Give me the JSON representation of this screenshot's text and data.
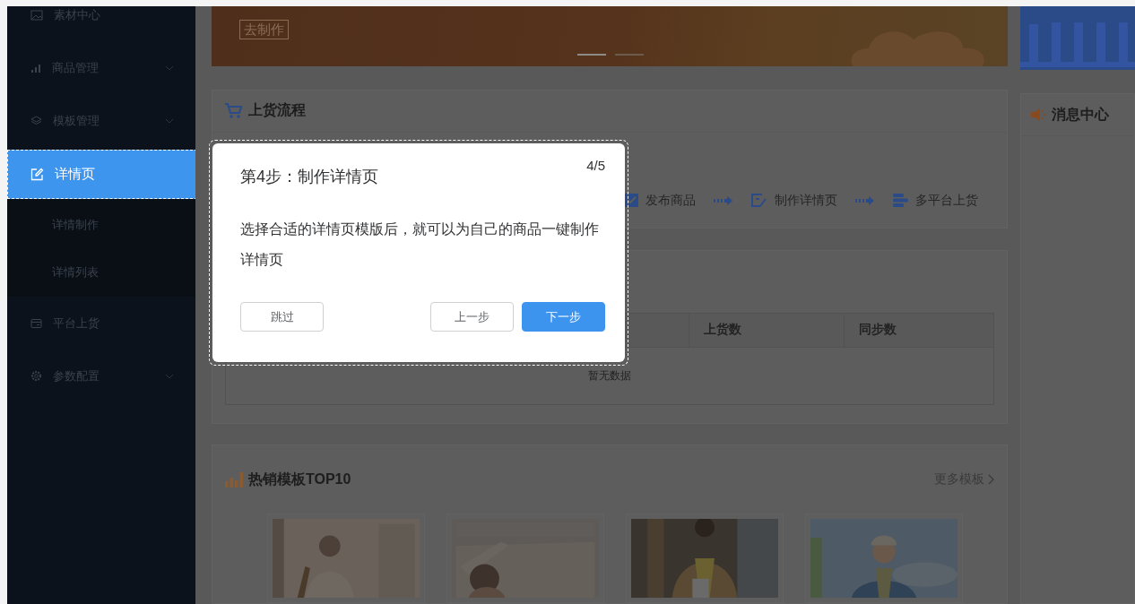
{
  "sidebar": {
    "items": [
      {
        "label": "素材中心",
        "kind": "link",
        "selected": false
      },
      {
        "label": "商品管理",
        "kind": "submenu",
        "selected": false
      },
      {
        "label": "模板管理",
        "kind": "submenu",
        "selected": false
      },
      {
        "label": "详情页",
        "kind": "link",
        "selected": true,
        "children": [
          {
            "label": "详情制作",
            "selected": false
          },
          {
            "label": "详情列表",
            "selected": false
          }
        ]
      },
      {
        "label": "平台上货",
        "kind": "link",
        "selected": false
      },
      {
        "label": "参数配置",
        "kind": "submenu",
        "selected": false
      }
    ]
  },
  "banner": {
    "button": "去制作",
    "slides": [
      {
        "selected": true
      },
      {
        "selected": false
      }
    ]
  },
  "flow_card": {
    "title": "上货流程",
    "steps": [
      "发布商品",
      "制作详情页",
      "多平台上货"
    ]
  },
  "table_card": {
    "columns": [
      "上货数",
      "同步数"
    ],
    "empty_text": "暂无数据"
  },
  "top_card": {
    "title": "热销模板TOP10",
    "more_link": "更多模板"
  },
  "message_card": {
    "title": "消息中心"
  },
  "tour_dialog": {
    "title": "第4步：制作详情页",
    "counter": "4/5",
    "body": "选择合适的详情页模版后，就可以为自己的商品一键制作详情页",
    "buttons": [
      {
        "label": "跳过",
        "kind": "plain"
      },
      {
        "label": "上一步",
        "kind": "plain"
      },
      {
        "label": "下一步",
        "kind": "primary"
      }
    ]
  }
}
